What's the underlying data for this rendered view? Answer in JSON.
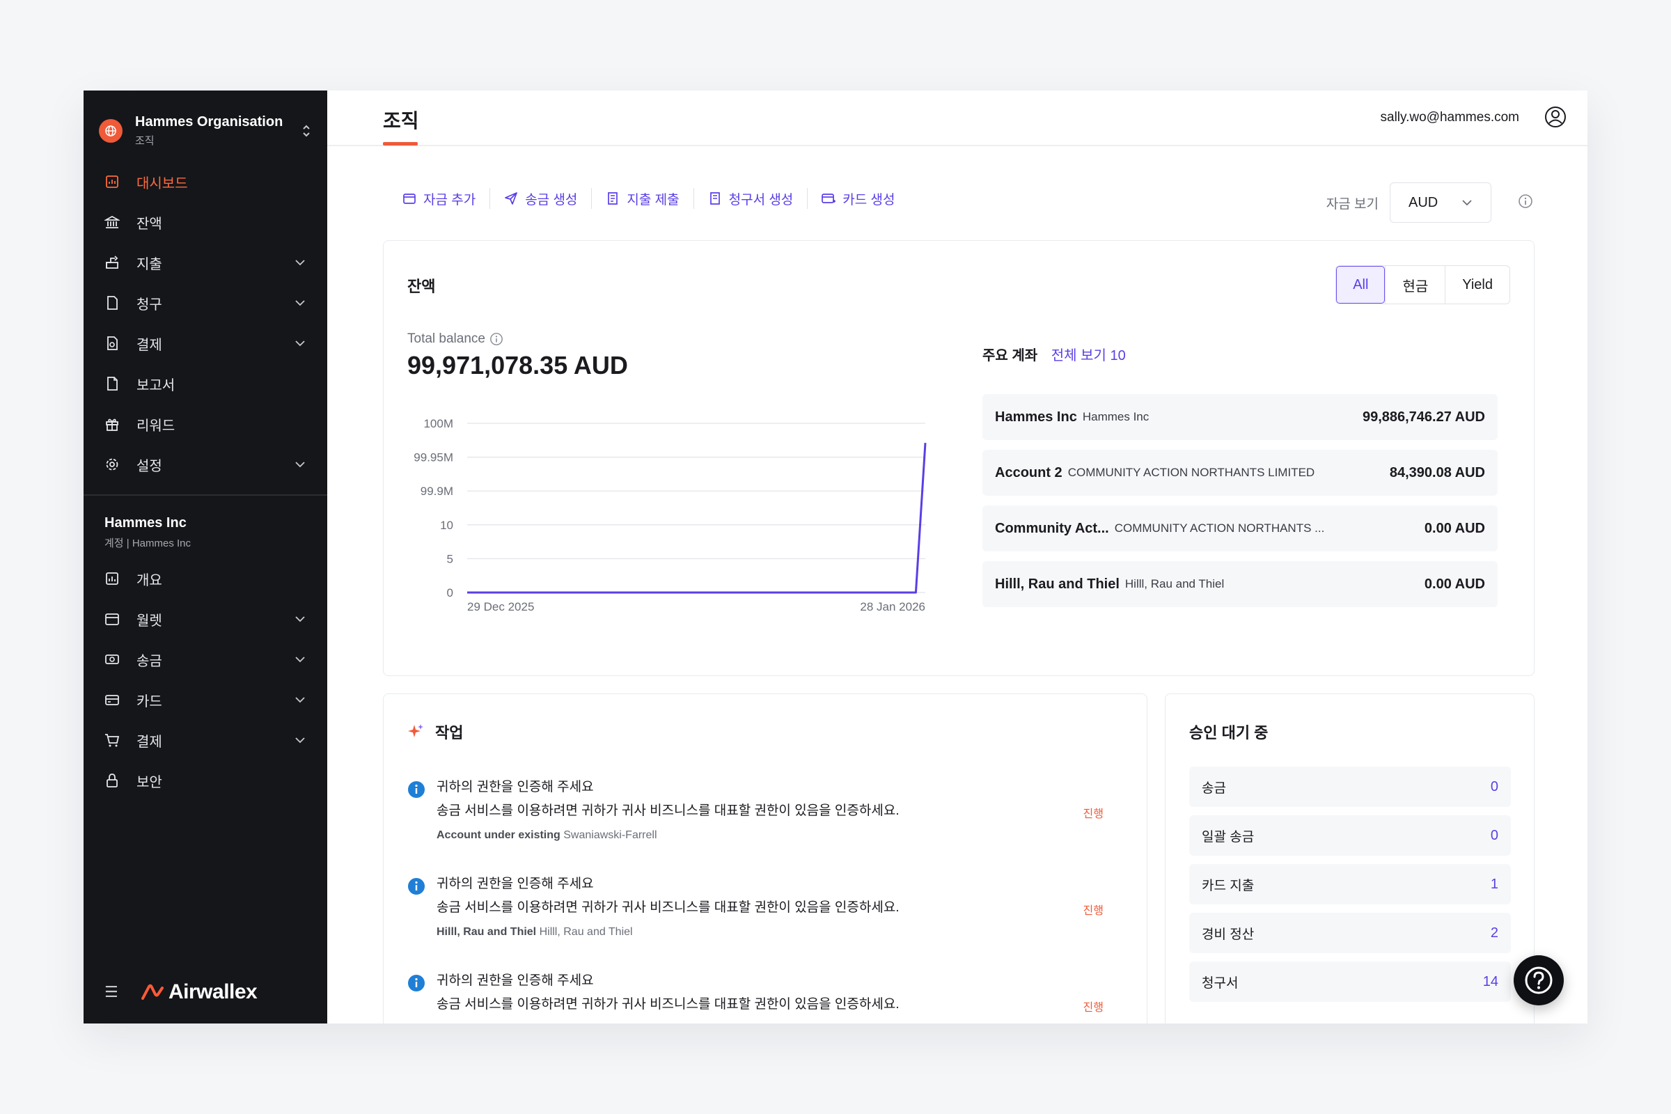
{
  "org": {
    "name": "Hammes Organisation",
    "sub": "조직"
  },
  "nav_main": [
    {
      "label": "대시보드",
      "icon": "dashboard-icon",
      "active": true,
      "chevron": false
    },
    {
      "label": "잔액",
      "icon": "bank-icon",
      "active": false,
      "chevron": false
    },
    {
      "label": "지출",
      "icon": "spend-icon",
      "active": false,
      "chevron": true
    },
    {
      "label": "청구",
      "icon": "bill-icon",
      "active": false,
      "chevron": true
    },
    {
      "label": "결제",
      "icon": "payment-doc-icon",
      "active": false,
      "chevron": true
    },
    {
      "label": "보고서",
      "icon": "report-icon",
      "active": false,
      "chevron": false
    },
    {
      "label": "리워드",
      "icon": "gift-icon",
      "active": false,
      "chevron": false
    },
    {
      "label": "설정",
      "icon": "gear-icon",
      "active": false,
      "chevron": true
    }
  ],
  "account": {
    "name": "Hammes Inc",
    "sub": "계정 | Hammes Inc"
  },
  "nav_account": [
    {
      "label": "개요",
      "icon": "overview-icon",
      "chevron": false
    },
    {
      "label": "월렛",
      "icon": "wallet-icon",
      "chevron": true
    },
    {
      "label": "송금",
      "icon": "transfer-icon",
      "chevron": true
    },
    {
      "label": "카드",
      "icon": "card-icon",
      "chevron": true
    },
    {
      "label": "결제",
      "icon": "cart-icon",
      "chevron": true
    },
    {
      "label": "보안",
      "icon": "lock-icon",
      "chevron": false
    }
  ],
  "brand": {
    "name": "Airwallex"
  },
  "header": {
    "title": "조직",
    "email": "sally.wo@hammes.com"
  },
  "actions": [
    {
      "label": "자금 추가",
      "icon": "wallet-add-icon"
    },
    {
      "label": "송금 생성",
      "icon": "send-icon"
    },
    {
      "label": "지출 제출",
      "icon": "receipt-icon"
    },
    {
      "label": "청구서 생성",
      "icon": "invoice-icon"
    },
    {
      "label": "카드 생성",
      "icon": "card-create-icon"
    }
  ],
  "view": {
    "label": "자금 보기",
    "currency": "AUD"
  },
  "balance": {
    "title": "잔액",
    "segments": [
      "All",
      "현금",
      "Yield"
    ],
    "active_segment": "All",
    "total_label": "Total balance",
    "total_value": "99,971,078.35 AUD"
  },
  "chart_data": {
    "type": "line",
    "x_labels": [
      "29 Dec 2025",
      "28 Jan 2026"
    ],
    "y_ticks": [
      "0",
      "5",
      "10",
      "99.9M",
      "99.95M",
      "100M"
    ],
    "series": [
      {
        "values": [
          0,
          0,
          0,
          0,
          0,
          0,
          0,
          0,
          0,
          0,
          0,
          0,
          0,
          0,
          0,
          0,
          0,
          0,
          0,
          0,
          0,
          0,
          0,
          0,
          0,
          0,
          0,
          0,
          0,
          99971078.35
        ]
      }
    ],
    "color": "#5a3ee6",
    "grid": true
  },
  "accounts": {
    "title": "주요 계좌",
    "link": "전체 보기 10",
    "rows": [
      {
        "name": "Hammes Inc",
        "sub": "Hammes Inc",
        "amount": "99,886,746.27 AUD"
      },
      {
        "name": "Account 2",
        "sub": "COMMUNITY ACTION NORTHANTS LIMITED",
        "amount": "84,390.08 AUD"
      },
      {
        "name": "Community Act...",
        "sub": "COMMUNITY ACTION NORTHANTS ...",
        "amount": "0.00 AUD"
      },
      {
        "name": "Hilll, Rau and Thiel",
        "sub": "Hilll, Rau and Thiel",
        "amount": "0.00 AUD"
      }
    ]
  },
  "tasks": {
    "title": "작업",
    "items": [
      {
        "title": "귀하의 권한을 인증해 주세요",
        "desc": "송금 서비스를 이용하려면 귀하가 귀사 비즈니스를 대표할 권한이 있음을 인증하세요.",
        "meta_bold": "Account under existing",
        "meta": "Swaniawski-Farrell",
        "status": "진행"
      },
      {
        "title": "귀하의 권한을 인증해 주세요",
        "desc": "송금 서비스를 이용하려면 귀하가 귀사 비즈니스를 대표할 권한이 있음을 인증하세요.",
        "meta_bold": "Hilll, Rau and Thiel",
        "meta": "Hilll, Rau and Thiel",
        "status": "진행"
      },
      {
        "title": "귀하의 권한을 인증해 주세요",
        "desc": "송금 서비스를 이용하려면 귀하가 귀사 비즈니스를 대표할 권한이 있음을 인증하세요.",
        "meta_bold": "",
        "meta": "",
        "status": "진행"
      }
    ]
  },
  "approvals": {
    "title": "승인 대기 중",
    "rows": [
      {
        "label": "송금",
        "count": "0"
      },
      {
        "label": "일괄 송금",
        "count": "0"
      },
      {
        "label": "카드 지출",
        "count": "1"
      },
      {
        "label": "경비 정산",
        "count": "2"
      },
      {
        "label": "청구서",
        "count": "14"
      }
    ]
  }
}
